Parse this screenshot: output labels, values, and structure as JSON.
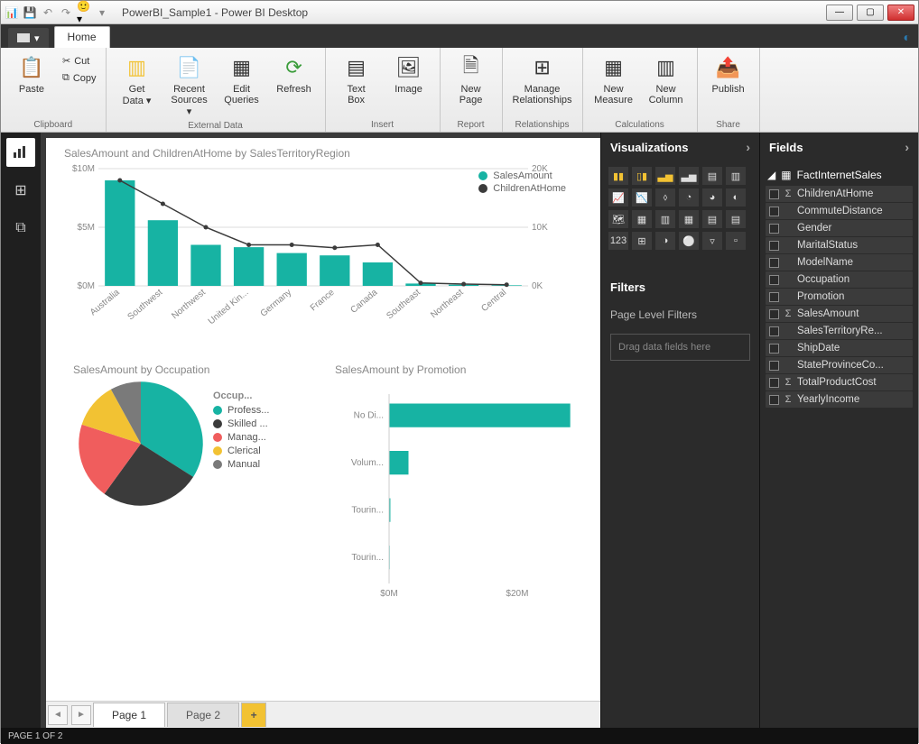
{
  "title": "PowerBI_Sample1 - Power BI Desktop",
  "tabs": {
    "file": "",
    "home": "Home"
  },
  "ribbon": {
    "clipboard": {
      "label": "Clipboard",
      "paste": "Paste",
      "cut": "Cut",
      "copy": "Copy"
    },
    "external": {
      "label": "External Data",
      "getdata": "Get\nData ▾",
      "recent": "Recent\nSources ▾",
      "edit": "Edit\nQueries",
      "refresh": "Refresh"
    },
    "insert": {
      "label": "Insert",
      "textbox": "Text\nBox",
      "image": "Image"
    },
    "report": {
      "label": "Report",
      "newpage": "New\nPage"
    },
    "relationships": {
      "label": "Relationships",
      "manage": "Manage\nRelationships"
    },
    "calculations": {
      "label": "Calculations",
      "measure": "New\nMeasure",
      "column": "New\nColumn"
    },
    "share": {
      "label": "Share",
      "publish": "Publish"
    }
  },
  "pages": {
    "p1": "Page 1",
    "p2": "Page 2"
  },
  "status": "PAGE 1 OF 2",
  "viz_header": "Visualizations",
  "filters_header": "Filters",
  "filters_sub": "Page Level Filters",
  "filters_drop": "Drag data fields here",
  "fields_header": "Fields",
  "fields_table": "FactInternetSales",
  "fields": [
    {
      "name": "ChildrenAtHome",
      "sigma": true
    },
    {
      "name": "CommuteDistance",
      "sigma": false
    },
    {
      "name": "Gender",
      "sigma": false
    },
    {
      "name": "MaritalStatus",
      "sigma": false
    },
    {
      "name": "ModelName",
      "sigma": false
    },
    {
      "name": "Occupation",
      "sigma": false
    },
    {
      "name": "Promotion",
      "sigma": false
    },
    {
      "name": "SalesAmount",
      "sigma": true
    },
    {
      "name": "SalesTerritoryRe...",
      "sigma": false
    },
    {
      "name": "ShipDate",
      "sigma": false
    },
    {
      "name": "StateProvinceCo...",
      "sigma": false
    },
    {
      "name": "TotalProductCost",
      "sigma": true
    },
    {
      "name": "YearlyIncome",
      "sigma": true
    }
  ],
  "chart_data": [
    {
      "type": "bar+line",
      "title": "SalesAmount and ChildrenAtHome by SalesTerritoryRegion",
      "categories": [
        "Australia",
        "Southwest",
        "Northwest",
        "United Kin...",
        "Germany",
        "France",
        "Canada",
        "Southeast",
        "Northeast",
        "Central"
      ],
      "series": [
        {
          "name": "SalesAmount",
          "kind": "bar",
          "color": "#17b3a3",
          "values": [
            9.0,
            5.6,
            3.5,
            3.3,
            2.8,
            2.6,
            2.0,
            0.2,
            0.1,
            0.05
          ]
        },
        {
          "name": "ChildrenAtHome",
          "kind": "line",
          "color": "#3b3b3b",
          "values": [
            18,
            14,
            10,
            7,
            7,
            6.5,
            7,
            0.5,
            0.3,
            0.2
          ]
        }
      ],
      "y1": {
        "label": "",
        "ticks": [
          "$0M",
          "$5M",
          "$10M"
        ],
        "max": 10
      },
      "y2": {
        "label": "",
        "ticks": [
          "0K",
          "10K",
          "20K"
        ],
        "max": 20
      }
    },
    {
      "type": "pie",
      "title": "SalesAmount by Occupation",
      "legend_title": "Occup...",
      "slices": [
        {
          "name": "Profess...",
          "value": 34,
          "color": "#17b3a3"
        },
        {
          "name": "Skilled ...",
          "value": 26,
          "color": "#3b3b3b"
        },
        {
          "name": "Manag...",
          "value": 20,
          "color": "#f05d5d"
        },
        {
          "name": "Clerical",
          "value": 12,
          "color": "#f2c233"
        },
        {
          "name": "Manual",
          "value": 8,
          "color": "#7a7a7a"
        }
      ]
    },
    {
      "type": "bar-horizontal",
      "title": "SalesAmount by Promotion",
      "categories": [
        "No Di...",
        "Volum...",
        "Tourin...",
        "Tourin..."
      ],
      "values": [
        28,
        3,
        0.2,
        0.1
      ],
      "xticks": [
        "$0M",
        "$20M"
      ],
      "xmax": 30,
      "color": "#17b3a3"
    }
  ]
}
